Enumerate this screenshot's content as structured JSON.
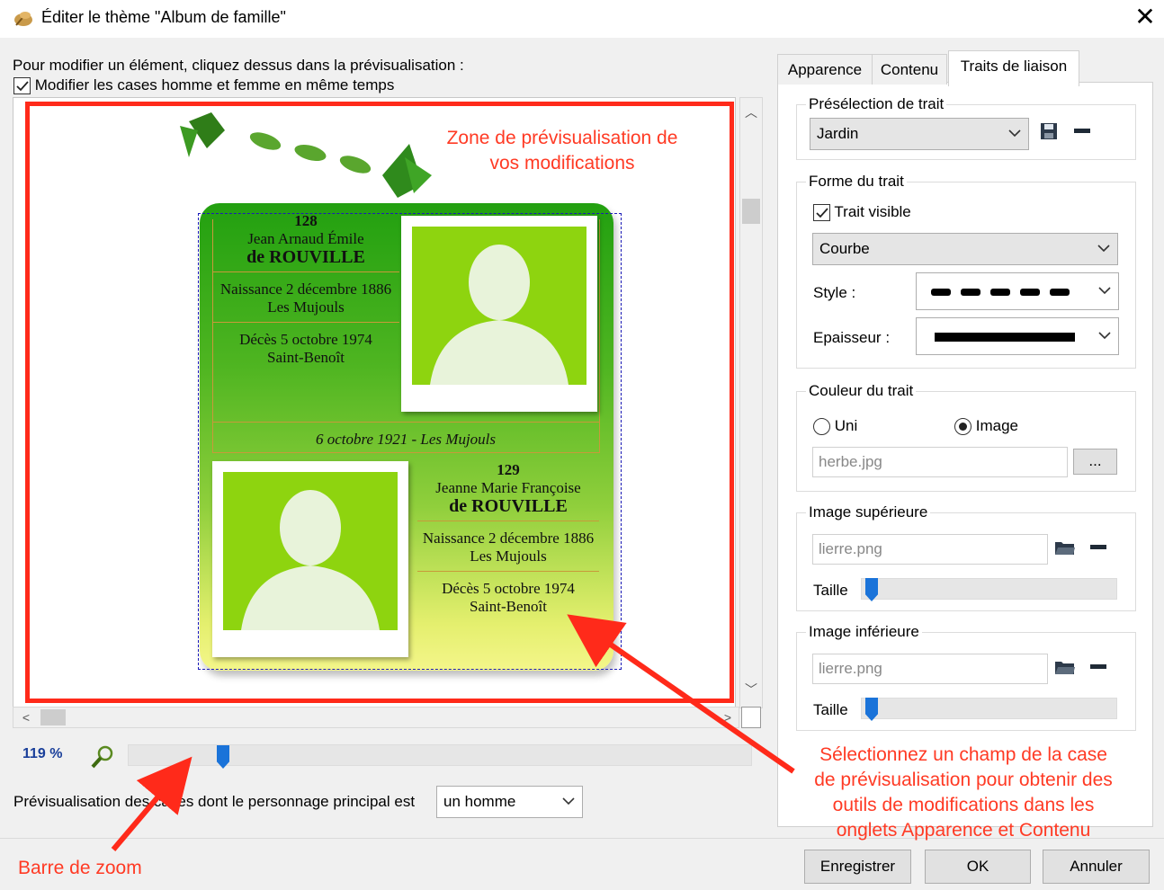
{
  "window": {
    "title": "Éditer le thème \"Album de famille\""
  },
  "left": {
    "instruction": "Pour modifier un élément, cliquez dessus dans la prévisualisation :",
    "sync_checkbox_label": "Modifier les cases homme et femme en même temps",
    "sync_checked": true
  },
  "preview": {
    "annotation": [
      "Zone de prévisualisation de",
      "vos modifications"
    ],
    "card": {
      "person1": {
        "number": "128",
        "firstnames": "Jean Arnaud  Émile",
        "surname": "de ROUVILLE",
        "birth": "Naissance 2 décembre 1886",
        "birth_place": "Les Mujouls",
        "death": "Décès 5 octobre 1974",
        "death_place": "Saint-Benoît"
      },
      "marriage": "6 octobre 1921 - Les Mujouls",
      "person2": {
        "number": "129",
        "firstnames": "Jeanne Marie  Françoise",
        "surname": "de ROUVILLE",
        "birth": "Naissance 2 décembre 1886",
        "birth_place": "Les Mujouls",
        "death": "Décès 5 octobre 1974",
        "death_place": "Saint-Benoît"
      }
    }
  },
  "zoom": {
    "label": "119 %",
    "value_percent": 119,
    "slider_fraction": 0.14
  },
  "preview_sex": {
    "label": "Prévisualisation des cases dont le personnage principal est",
    "value": "un homme"
  },
  "annotations": {
    "zoom_bar": "Barre de zoom",
    "select_hint": [
      "Sélectionnez un champ de la case",
      "de prévisualisation pour obtenir des",
      "outils  de modifications dans les",
      "onglets Apparence et Contenu"
    ]
  },
  "tabs": [
    {
      "label": "Apparence"
    },
    {
      "label": "Contenu"
    },
    {
      "label": "Traits de liaison"
    }
  ],
  "active_tab": "Traits de liaison",
  "preselection": {
    "title": "Présélection de trait",
    "value": "Jardin"
  },
  "forme": {
    "title": "Forme du trait",
    "visible_label": "Trait visible",
    "visible_checked": true,
    "shape": "Courbe",
    "style_label": "Style :",
    "thickness_label": "Epaisseur :"
  },
  "couleur": {
    "title": "Couleur du trait",
    "uni_label": "Uni",
    "image_label": "Image",
    "selected": "Image",
    "file": "herbe.jpg",
    "browse_label": "..."
  },
  "image_sup": {
    "title": "Image supérieure",
    "file": "lierre.png",
    "size_label": "Taille",
    "size_fraction": 0.0
  },
  "image_inf": {
    "title": "Image inférieure",
    "file": "lierre.png",
    "size_label": "Taille",
    "size_fraction": 0.0
  },
  "buttons": {
    "save": "Enregistrer",
    "ok": "OK",
    "cancel": "Annuler"
  },
  "colors": {
    "annotation_red": "#ff2a1a",
    "card_green": "#22a010",
    "card_yellow": "#f4f68a",
    "slider_blue": "#1a73d9"
  }
}
